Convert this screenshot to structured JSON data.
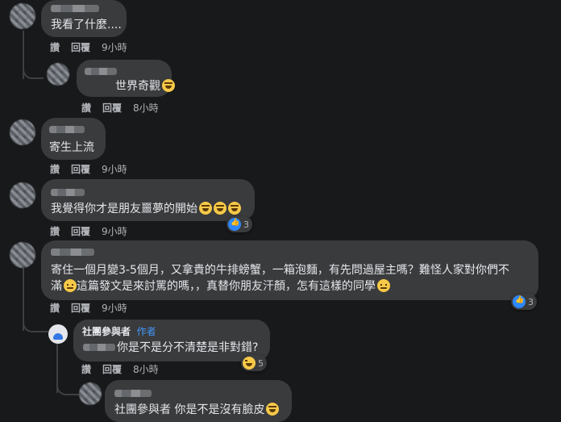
{
  "actions": {
    "like": "讚",
    "reply": "回覆"
  },
  "comments": [
    {
      "text": "我看了什麼....",
      "time": "9小時"
    },
    {
      "text": "世界奇觀",
      "time": "8小時"
    },
    {
      "text": "寄生上流",
      "time": "9小時"
    },
    {
      "text": "我覺得你才是朋友噩夢的開始",
      "time": "9小時",
      "reaction_count": "3"
    },
    {
      "line1": "寄住一個月變3-5個月，又拿貴的牛排螃蟹，一箱泡麵，有先問過屋主嗎？難怪人家對你們不",
      "line2a": "滿",
      "line2b": "這篇發文是來討罵的嗎，，真替你朋友汗顏，怎有這樣的同學",
      "time": "9小時",
      "reaction_count": "3"
    },
    {
      "author": "社團參與者",
      "badge": "作者",
      "text": "你是不是分不清楚是非對錯?",
      "time": "8小時",
      "reaction_count": "5"
    },
    {
      "text": "社團參與者 你是不是沒有臉皮"
    }
  ]
}
